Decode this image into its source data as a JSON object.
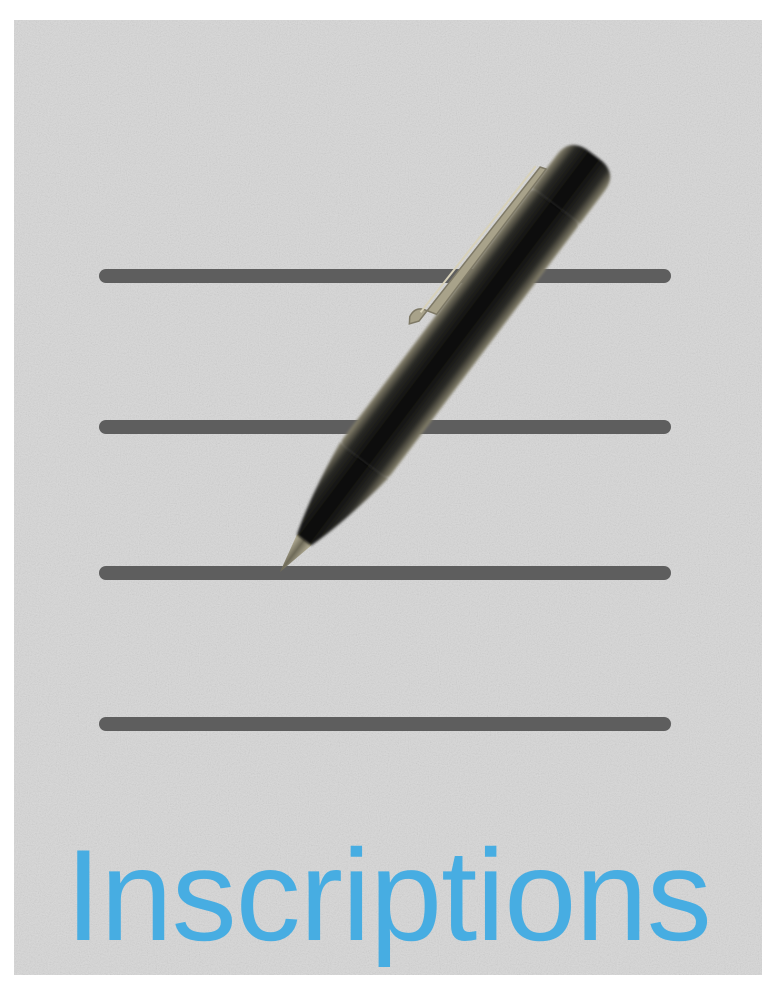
{
  "app": {
    "title": "Inscriptions"
  },
  "icon": {
    "name": "pen-on-lined-paper-icon",
    "ruled_line_count": 4
  },
  "colors": {
    "paper": "#d6d6d6",
    "ruled_line": "#5e5e5e",
    "pen_body": "#111111",
    "pen_clip": "#a8a28a",
    "title_text": "#47ade2"
  }
}
